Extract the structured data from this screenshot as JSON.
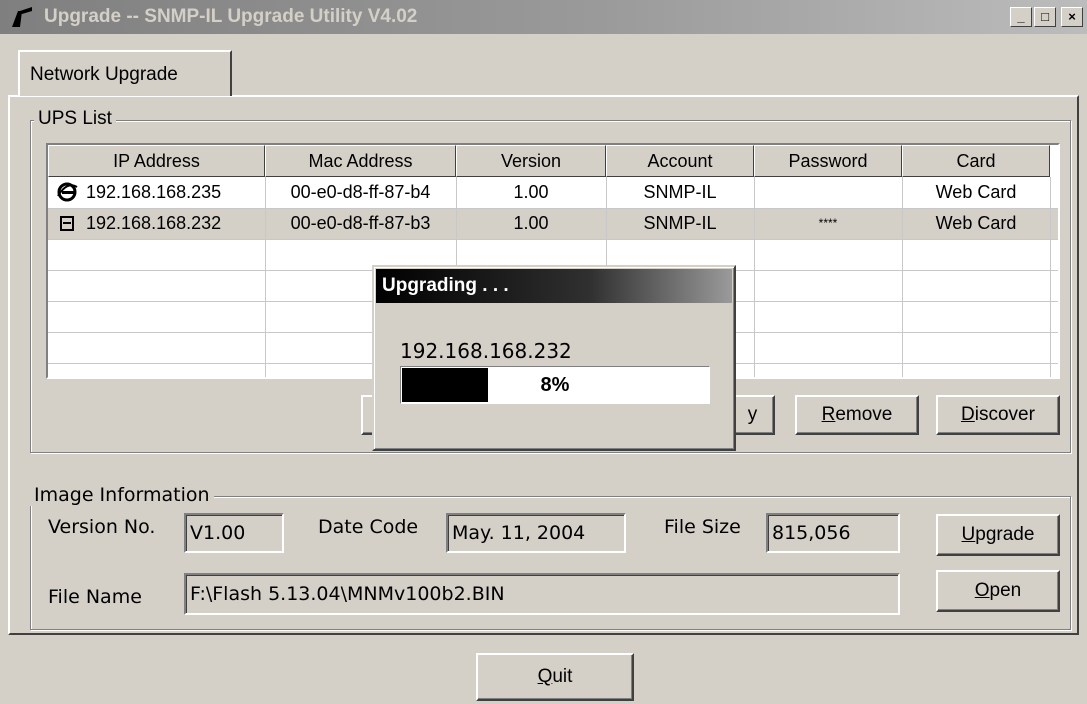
{
  "window": {
    "title": "Upgrade --  SNMP-IL Upgrade Utility V4.02",
    "controls": {
      "minimize": "_",
      "maximize": "□",
      "close": "×"
    }
  },
  "tabs": [
    {
      "label": "Network Upgrade",
      "selected": true
    }
  ],
  "ups_list": {
    "legend": "UPS List",
    "columns": [
      "IP Address",
      "Mac Address",
      "Version",
      "Account",
      "Password",
      "Card"
    ],
    "rows": [
      {
        "icon": "internet-explorer-icon",
        "ip": "192.168.168.235",
        "mac": "00-e0-d8-ff-87-b4",
        "version": "1.00",
        "account": "SNMP-IL",
        "password": "",
        "card": "Web Card",
        "selected": false
      },
      {
        "icon": "device-icon",
        "ip": "192.168.168.232",
        "mac": "00-e0-d8-ff-87-b3",
        "version": "1.00",
        "account": "SNMP-IL",
        "password": "****",
        "card": "Web Card",
        "selected": true
      }
    ],
    "buttons": {
      "partial_left": "",
      "partial_right": "y",
      "remove": "Remove",
      "discover": "Discover"
    }
  },
  "image_info": {
    "legend": "Image Information",
    "version_label": "Version No.",
    "version_value": "V1.00",
    "date_label": "Date Code",
    "date_value": "May. 11, 2004",
    "size_label": "File Size",
    "size_value": "815,056",
    "file_label": "File Name",
    "file_value": "F:\\Flash 5.13.04\\MNMv100b2.BIN",
    "upgrade_button": "Upgrade",
    "open_button": "Open"
  },
  "quit_button": "Quit",
  "dialog": {
    "title": "Upgrading . . .",
    "target_ip": "192.168.168.232",
    "progress": 0.08,
    "progress_text": "8%"
  }
}
